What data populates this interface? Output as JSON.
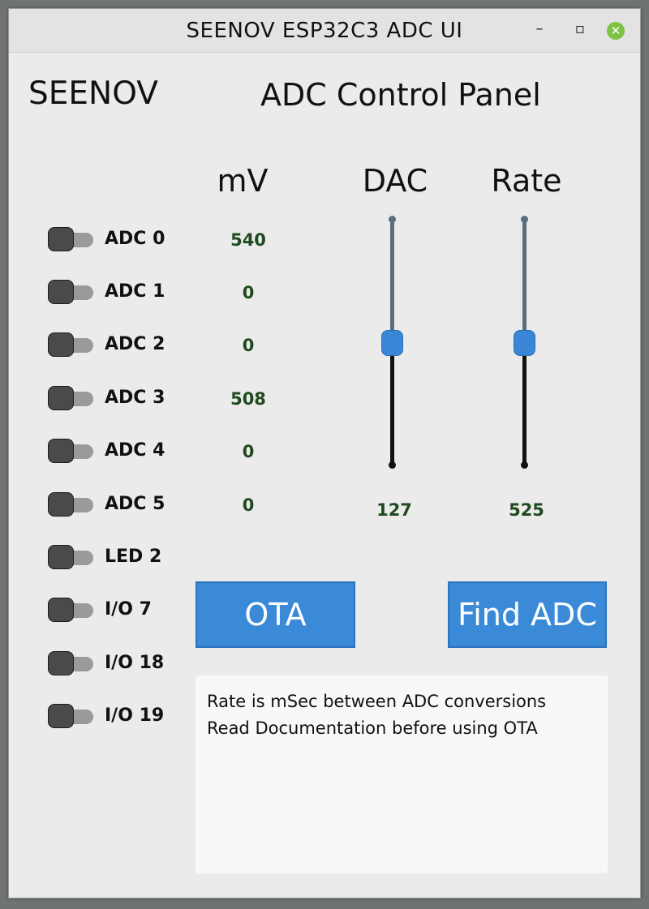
{
  "window": {
    "title": "SEENOV ESP32C3 ADC UI",
    "minimize_glyph": "–",
    "maximize_glyph": "▫",
    "close_glyph": "✕"
  },
  "brand": "SEENOV",
  "panel_title": "ADC Control Panel",
  "columns": {
    "mv": "mV",
    "dac": "DAC",
    "rate": "Rate"
  },
  "toggles": [
    {
      "label": "ADC 0",
      "on": false
    },
    {
      "label": "ADC 1",
      "on": false
    },
    {
      "label": "ADC 2",
      "on": false
    },
    {
      "label": "ADC 3",
      "on": false
    },
    {
      "label": "ADC 4",
      "on": false
    },
    {
      "label": "ADC 5",
      "on": false
    },
    {
      "label": "LED 2",
      "on": false
    },
    {
      "label": "I/O 7",
      "on": false
    },
    {
      "label": "I/O 18",
      "on": false
    },
    {
      "label": "I/O 19",
      "on": false
    }
  ],
  "mv_values": [
    "540",
    "0",
    "0",
    "508",
    "0",
    "0"
  ],
  "sliders": {
    "dac": {
      "value": "127",
      "level_fraction": 0.5
    },
    "rate": {
      "value": "525",
      "level_fraction": 0.5
    }
  },
  "buttons": {
    "ota": "OTA",
    "find_adc": "Find ADC"
  },
  "messages": [
    "Rate is mSec between ADC conversions",
    "Read Documentation before using OTA"
  ],
  "colors": {
    "accent": "#3a8ad8",
    "value_text": "#1f4a1f",
    "close_button": "#7cc243"
  },
  "icons": {
    "minimize": "minimize-icon",
    "maximize": "maximize-icon",
    "close": "close-icon"
  }
}
